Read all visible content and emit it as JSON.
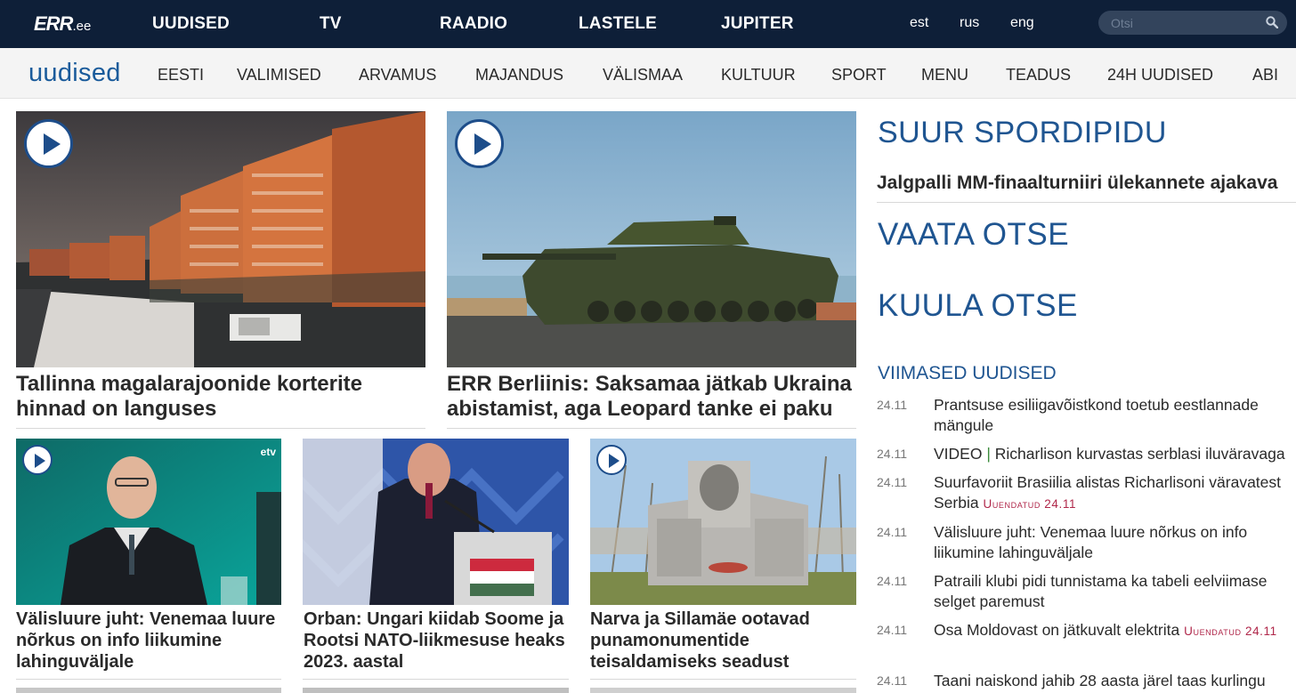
{
  "header": {
    "logo_main": "ERR",
    "logo_domain": ".ee",
    "nav": [
      "UUDISED",
      "TV",
      "RAADIO",
      "LASTELE",
      "JUPITER"
    ],
    "langs": [
      "est",
      "rus",
      "eng"
    ],
    "search_placeholder": "Otsi"
  },
  "subnav": {
    "brand": "uudised",
    "items": [
      "EESTI",
      "VALIMISED",
      "ARVAMUS",
      "MAJANDUS",
      "VÄLISMAA",
      "KULTUUR",
      "SPORT",
      "MENU",
      "TEADUS",
      "24H UUDISED",
      "ABI"
    ]
  },
  "articles": [
    {
      "title": "Tallinna magalarajoonide korterite hinnad on languses",
      "video": true
    },
    {
      "title": "ERR Berliinis: Saksamaa jätkab Ukraina abistamist, aga Leopard tanke ei paku",
      "video": true
    },
    {
      "title": "Välisluure juht: Venemaa luure nõrkus on info liikumine lahinguväljale",
      "video": true,
      "channel_badge": "etv"
    },
    {
      "title": "Orban: Ungari kiidab Soome ja Rootsi NATO-liikmesuse heaks 2023. aastal",
      "video": false
    },
    {
      "title": "Narva ja Sillamäe ootavad punamonumentide teisaldamiseks seadust",
      "video": true
    }
  ],
  "sidebar": {
    "sport_title": "SUUR SPORDIPIDU",
    "sport_link": "Jalgpalli MM-finaalturniiri ülekannete ajakava",
    "vaata": "VAATA OTSE",
    "kuula": "KUULA OTSE",
    "latest_title": "VIIMASED UUDISED",
    "latest": [
      {
        "time": "24.11",
        "text": "Prantsuse esiliigavõistkond toetub eestlannade mängule"
      },
      {
        "time": "24.11",
        "prefix": "VIDEO",
        "sep": "|",
        "text": "Richarlison kurvastas serblasi iluväravaga"
      },
      {
        "time": "24.11",
        "text": "Suurfavoriit Brasiilia alistas Richarlisoni väravatest Serbia",
        "updated": "Uuendatud 24.11"
      },
      {
        "time": "24.11",
        "text": "Välisluure juht: Venemaa luure nõrkus on info liikumine lahinguväljale"
      },
      {
        "time": "24.11",
        "text": "Patraili klubi pidi tunnistama ka tabeli eelviimase selget paremust"
      },
      {
        "time": "24.11",
        "text": "Osa Moldovast on jätkuvalt elektrita",
        "updated": "Uuendatud 24.11"
      },
      {
        "time": "24.11",
        "text": "Taani naiskond jahib 28 aasta järel taas kurlingu"
      }
    ]
  },
  "colors": {
    "topbar": "#0e1f38",
    "accent": "#1f5591",
    "updated": "#b0274a"
  }
}
